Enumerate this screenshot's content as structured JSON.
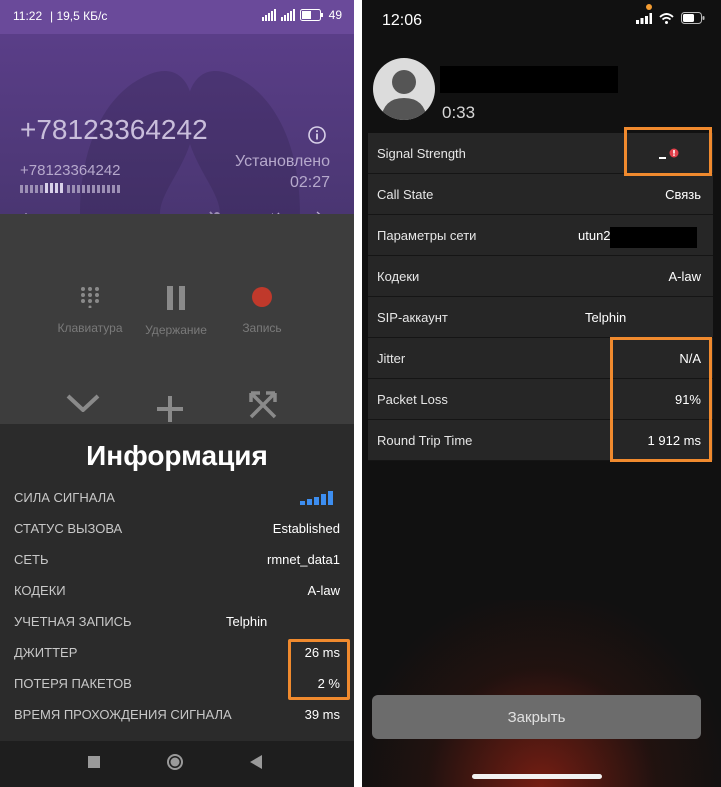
{
  "android": {
    "status_bar": {
      "time": "11:22",
      "network_speed": "| 19,5 КБ/с",
      "battery": "49"
    },
    "call": {
      "number": "+78123364242",
      "number_small": "+78123364242",
      "status": "Установлено",
      "duration": "02:27"
    },
    "controls": {
      "keypad": "Клавиатура",
      "hold": "Удержание",
      "record": "Запись"
    },
    "info": {
      "title": "Информация",
      "rows": [
        {
          "key": "СИЛА СИГНАЛА",
          "value": ""
        },
        {
          "key": "СТАТУС ВЫЗОВА",
          "value": "Established"
        },
        {
          "key": "СЕТЬ",
          "value": "rmnet_data1"
        },
        {
          "key": "КОДЕКИ",
          "value": "A-law"
        },
        {
          "key": "УЧЕТНАЯ ЗАПИСЬ",
          "value": "Telphin"
        },
        {
          "key": "ДЖИТТЕР",
          "value": "26 ms"
        },
        {
          "key": "ПОТЕРЯ ПАКЕТОВ",
          "value": "2 %"
        },
        {
          "key": "ВРЕМЯ ПРОХОЖДЕНИЯ СИГНАЛА",
          "value": "39 ms"
        }
      ],
      "signal_strength_bars": 5
    },
    "colors": {
      "header": "#5a3e88",
      "status_bar": "#6a4a9a",
      "highlight": "#f08a2e",
      "signal": "#3d8ef0"
    }
  },
  "ios": {
    "status_bar": {
      "time": "12:06"
    },
    "call": {
      "duration": "0:33"
    },
    "rows": [
      {
        "key": "Signal Strength",
        "value": ""
      },
      {
        "key": "Call State",
        "value": "Связь"
      },
      {
        "key": "Параметры сети",
        "value": "utun2"
      },
      {
        "key": "Кодеки",
        "value": "A-law"
      },
      {
        "key": "SIP-аккаунт",
        "value": "Telphin"
      },
      {
        "key": "Jitter",
        "value": "N/A"
      },
      {
        "key": "Packet Loss",
        "value": "91%"
      },
      {
        "key": "Round Trip Time",
        "value": "1 912 ms"
      }
    ],
    "close_button": "Закрыть",
    "colors": {
      "highlight": "#f08a2e",
      "warning": "#e0404a"
    }
  }
}
